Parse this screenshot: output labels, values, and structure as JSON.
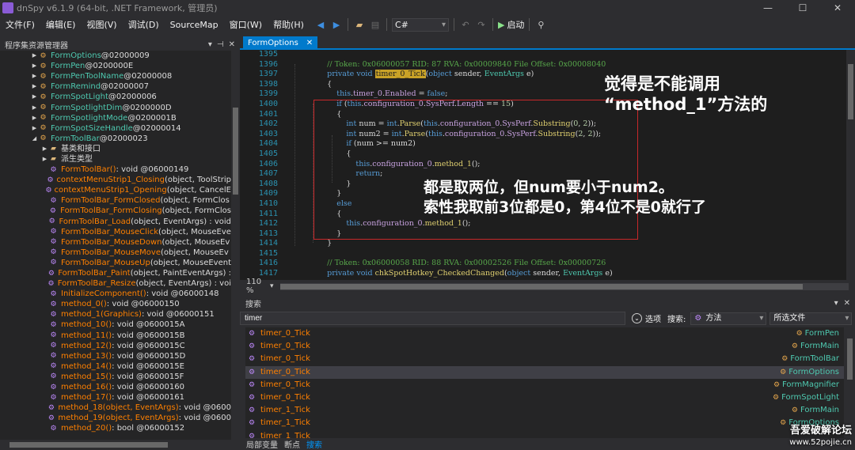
{
  "window": {
    "title": "dnSpy v6.1.9 (64-bit, .NET Framework, 管理员)",
    "controls": [
      "—",
      "☐",
      "✕"
    ]
  },
  "menu": [
    "文件(F)",
    "编辑(E)",
    "视图(V)",
    "调试(D)",
    "SourceMap",
    "窗口(W)",
    "帮助(H)"
  ],
  "toolbar": {
    "language": "C#",
    "run_label": "启动"
  },
  "left_pane": {
    "title": "程序集资源管理器",
    "tree": [
      {
        "indent": 3,
        "exp": "▶",
        "icon": "class",
        "name": "FormOptions",
        "token": " @02000009"
      },
      {
        "indent": 3,
        "exp": "▶",
        "icon": "class",
        "name": "FormPen",
        "token": " @0200000E"
      },
      {
        "indent": 3,
        "exp": "▶",
        "icon": "class",
        "name": "FormPenToolName",
        "token": " @02000008"
      },
      {
        "indent": 3,
        "exp": "▶",
        "icon": "class",
        "name": "FormRemind",
        "token": " @02000007"
      },
      {
        "indent": 3,
        "exp": "▶",
        "icon": "class",
        "name": "FormSpotLight",
        "token": " @02000006"
      },
      {
        "indent": 3,
        "exp": "▶",
        "icon": "class",
        "name": "FormSpotlightDim",
        "token": " @0200000D"
      },
      {
        "indent": 3,
        "exp": "▶",
        "icon": "class",
        "name": "FormSpotlightMode",
        "token": " @0200001B"
      },
      {
        "indent": 3,
        "exp": "▶",
        "icon": "class",
        "name": "FormSpotSizeHandle",
        "token": " @02000014"
      },
      {
        "indent": 3,
        "exp": "◢",
        "icon": "class",
        "name": "FormToolBar",
        "token": " @02000023"
      },
      {
        "indent": 4,
        "exp": "▶",
        "icon": "folder",
        "name": "基类和接口",
        "token": ""
      },
      {
        "indent": 4,
        "exp": "▶",
        "icon": "folder",
        "name": "派生类型",
        "token": ""
      },
      {
        "indent": 4,
        "exp": "",
        "icon": "method",
        "name": "FormToolBar()",
        "token": " : void @06000149"
      },
      {
        "indent": 4,
        "exp": "",
        "icon": "method",
        "name": "contextMenuStrip1_Closing",
        "token": "(object, ToolStrip"
      },
      {
        "indent": 4,
        "exp": "",
        "icon": "method",
        "name": "contextMenuStrip1_Opening",
        "token": "(object, CancelE"
      },
      {
        "indent": 4,
        "exp": "",
        "icon": "method",
        "name": "FormToolBar_FormClosed",
        "token": "(object, FormClos"
      },
      {
        "indent": 4,
        "exp": "",
        "icon": "method",
        "name": "FormToolBar_FormClosing",
        "token": "(object, FormClos"
      },
      {
        "indent": 4,
        "exp": "",
        "icon": "method",
        "name": "FormToolBar_Load",
        "token": "(object, EventArgs) : void"
      },
      {
        "indent": 4,
        "exp": "",
        "icon": "method",
        "name": "FormToolBar_MouseClick",
        "token": "(object, MouseEve"
      },
      {
        "indent": 4,
        "exp": "",
        "icon": "method",
        "name": "FormToolBar_MouseDown",
        "token": "(object, MouseEv"
      },
      {
        "indent": 4,
        "exp": "",
        "icon": "method",
        "name": "FormToolBar_MouseMove",
        "token": "(object, MouseEv"
      },
      {
        "indent": 4,
        "exp": "",
        "icon": "method",
        "name": "FormToolBar_MouseUp",
        "token": "(object, MouseEvent"
      },
      {
        "indent": 4,
        "exp": "",
        "icon": "method",
        "name": "FormToolBar_Paint",
        "token": "(object, PaintEventArgs) :"
      },
      {
        "indent": 4,
        "exp": "",
        "icon": "method",
        "name": "FormToolBar_Resize",
        "token": "(object, EventArgs) : voi"
      },
      {
        "indent": 4,
        "exp": "",
        "icon": "method",
        "name": "InitializeComponent()",
        "token": " : void @06000148"
      },
      {
        "indent": 4,
        "exp": "",
        "icon": "method",
        "name": "method_0()",
        "token": " : void @06000150"
      },
      {
        "indent": 4,
        "exp": "",
        "icon": "method",
        "name": "method_1(Graphics)",
        "token": " : void @06000151"
      },
      {
        "indent": 4,
        "exp": "",
        "icon": "method",
        "name": "method_10()",
        "token": " : void @0600015A"
      },
      {
        "indent": 4,
        "exp": "",
        "icon": "method",
        "name": "method_11()",
        "token": " : void @0600015B"
      },
      {
        "indent": 4,
        "exp": "",
        "icon": "method",
        "name": "method_12()",
        "token": " : void @0600015C"
      },
      {
        "indent": 4,
        "exp": "",
        "icon": "method",
        "name": "method_13()",
        "token": " : void @0600015D"
      },
      {
        "indent": 4,
        "exp": "",
        "icon": "method",
        "name": "method_14()",
        "token": " : void @0600015E"
      },
      {
        "indent": 4,
        "exp": "",
        "icon": "method",
        "name": "method_15()",
        "token": " : void @0600015F"
      },
      {
        "indent": 4,
        "exp": "",
        "icon": "method",
        "name": "method_16()",
        "token": " : void @06000160"
      },
      {
        "indent": 4,
        "exp": "",
        "icon": "method",
        "name": "method_17()",
        "token": " : void @06000161"
      },
      {
        "indent": 4,
        "exp": "",
        "icon": "method",
        "name": "method_18(object, EventArgs)",
        "token": " : void @0600"
      },
      {
        "indent": 4,
        "exp": "",
        "icon": "method",
        "name": "method_19(object, EventArgs)",
        "token": " : void @0600"
      },
      {
        "indent": 4,
        "exp": "",
        "icon": "method",
        "name": "method_20()",
        "token": " : bool @06000152"
      }
    ]
  },
  "editor": {
    "tab_label": "FormOptions",
    "zoom": "110 %",
    "line_numbers": [
      "1395",
      "1396",
      "1397",
      "1398",
      "1399",
      "1400",
      "1401",
      "1402",
      "1403",
      "1404",
      "1405",
      "1406",
      "1407",
      "1408",
      "1409",
      "1410",
      "1411",
      "1412",
      "1413",
      "1414",
      "1415",
      "1416",
      "1417",
      "1418"
    ],
    "lines": [
      [],
      [
        {
          "t": "        "
        },
        {
          "c": "cm",
          "t": "// Token: 0x06000057 RID: 87 RVA: 0x00009840 File Offset: 0x00008040"
        }
      ],
      [
        {
          "t": "        "
        },
        {
          "c": "kw",
          "t": "private void "
        },
        {
          "c": "hl",
          "t": "timer_0_Tick"
        },
        {
          "t": "("
        },
        {
          "c": "kw",
          "t": "object"
        },
        {
          "t": " sender, "
        },
        {
          "c": "ty",
          "t": "EventArgs"
        },
        {
          "t": " e)"
        }
      ],
      [
        {
          "t": "        {"
        }
      ],
      [
        {
          "t": "            "
        },
        {
          "c": "kw",
          "t": "this"
        },
        {
          "t": "."
        },
        {
          "c": "fld",
          "t": "timer_0"
        },
        {
          "t": "."
        },
        {
          "c": "fld",
          "t": "Enabled"
        },
        {
          "t": " = "
        },
        {
          "c": "kw",
          "t": "false"
        },
        {
          "t": ";"
        }
      ],
      [
        {
          "t": "            "
        },
        {
          "c": "kw",
          "t": "if"
        },
        {
          "t": " ("
        },
        {
          "c": "kw",
          "t": "this"
        },
        {
          "t": "."
        },
        {
          "c": "fld",
          "t": "configuration_0"
        },
        {
          "t": "."
        },
        {
          "c": "fld",
          "t": "SysPerf"
        },
        {
          "t": "."
        },
        {
          "c": "fld",
          "t": "Length"
        },
        {
          "t": " == "
        },
        {
          "c": "num",
          "t": "15"
        },
        {
          "t": ")"
        }
      ],
      [
        {
          "t": "            {"
        }
      ],
      [
        {
          "t": "                "
        },
        {
          "c": "kw",
          "t": "int"
        },
        {
          "t": " num = "
        },
        {
          "c": "kw",
          "t": "int"
        },
        {
          "t": "."
        },
        {
          "c": "mn",
          "t": "Parse"
        },
        {
          "t": "("
        },
        {
          "c": "kw",
          "t": "this"
        },
        {
          "t": "."
        },
        {
          "c": "fld",
          "t": "configuration_0"
        },
        {
          "t": "."
        },
        {
          "c": "fld",
          "t": "SysPerf"
        },
        {
          "t": "."
        },
        {
          "c": "mn",
          "t": "Substring"
        },
        {
          "t": "("
        },
        {
          "c": "num",
          "t": "0"
        },
        {
          "t": ", "
        },
        {
          "c": "num",
          "t": "2"
        },
        {
          "t": "));"
        }
      ],
      [
        {
          "t": "                "
        },
        {
          "c": "kw",
          "t": "int"
        },
        {
          "t": " num2 = "
        },
        {
          "c": "kw",
          "t": "int"
        },
        {
          "t": "."
        },
        {
          "c": "mn",
          "t": "Parse"
        },
        {
          "t": "("
        },
        {
          "c": "kw",
          "t": "this"
        },
        {
          "t": "."
        },
        {
          "c": "fld",
          "t": "configuration_0"
        },
        {
          "t": "."
        },
        {
          "c": "fld",
          "t": "SysPerf"
        },
        {
          "t": "."
        },
        {
          "c": "mn",
          "t": "Substring"
        },
        {
          "t": "("
        },
        {
          "c": "num",
          "t": "2"
        },
        {
          "t": ", "
        },
        {
          "c": "num",
          "t": "2"
        },
        {
          "t": "));"
        }
      ],
      [
        {
          "t": "                "
        },
        {
          "c": "kw",
          "t": "if"
        },
        {
          "t": " (num >= num2)"
        }
      ],
      [
        {
          "t": "                {"
        }
      ],
      [
        {
          "t": "                    "
        },
        {
          "c": "kw",
          "t": "this"
        },
        {
          "t": "."
        },
        {
          "c": "fld",
          "t": "configuration_0"
        },
        {
          "t": "."
        },
        {
          "c": "mn",
          "t": "method_1"
        },
        {
          "t": "();"
        }
      ],
      [
        {
          "t": "                    "
        },
        {
          "c": "kw",
          "t": "return"
        },
        {
          "t": ";"
        }
      ],
      [
        {
          "t": "                }"
        }
      ],
      [
        {
          "t": "            }"
        }
      ],
      [
        {
          "t": "            "
        },
        {
          "c": "kw",
          "t": "else"
        }
      ],
      [
        {
          "t": "            {"
        }
      ],
      [
        {
          "t": "                "
        },
        {
          "c": "kw",
          "t": "this"
        },
        {
          "t": "."
        },
        {
          "c": "fld",
          "t": "configuration_0"
        },
        {
          "t": "."
        },
        {
          "c": "mn",
          "t": "method_1"
        },
        {
          "t": "();"
        }
      ],
      [
        {
          "t": "            }"
        }
      ],
      [
        {
          "t": "        }"
        }
      ],
      [],
      [
        {
          "t": "        "
        },
        {
          "c": "cm",
          "t": "// Token: 0x06000058 RID: 88 RVA: 0x00002526 File Offset: 0x00000726"
        }
      ],
      [
        {
          "t": "        "
        },
        {
          "c": "kw",
          "t": "private void "
        },
        {
          "c": "mn",
          "t": "chkSpotHotkey_CheckedChanged"
        },
        {
          "t": "("
        },
        {
          "c": "kw",
          "t": "object"
        },
        {
          "t": " sender, "
        },
        {
          "c": "ty",
          "t": "EventArgs"
        },
        {
          "t": " e)"
        }
      ],
      [
        {
          "t": "        {"
        }
      ]
    ],
    "note1": "觉得是不能调用\n“method_1”方法的",
    "note2": "都是取两位，但num要小于num2。\n索性我取前3位都是0，第4位不是0就行了"
  },
  "search": {
    "title": "搜索",
    "query": "timer",
    "options_label": "选项",
    "search_label": "搜索:",
    "kind": "方法",
    "scope": "所选文件",
    "results": [
      {
        "name": "timer_0_Tick",
        "container": "FormPen",
        "selected": false
      },
      {
        "name": "timer_0_Tick",
        "container": "FormMain",
        "selected": false
      },
      {
        "name": "timer_0_Tick",
        "container": "FormToolBar",
        "selected": false
      },
      {
        "name": "timer_0_Tick",
        "container": "FormOptions",
        "selected": true
      },
      {
        "name": "timer_0_Tick",
        "container": "FormMagnifier",
        "selected": false
      },
      {
        "name": "timer_0_Tick",
        "container": "FormSpotLight",
        "selected": false
      },
      {
        "name": "timer_1_Tick",
        "container": "FormMain",
        "selected": false
      },
      {
        "name": "timer_1_Tick",
        "container": "FormOptions",
        "selected": false
      },
      {
        "name": "timer_1_Tick",
        "container": "",
        "selected": false
      }
    ]
  },
  "bottom_tabs": [
    "局部变量",
    "断点",
    "搜索"
  ],
  "watermark": {
    "line1": "吾爱破解论坛",
    "line2": "www.52pojie.cn"
  }
}
